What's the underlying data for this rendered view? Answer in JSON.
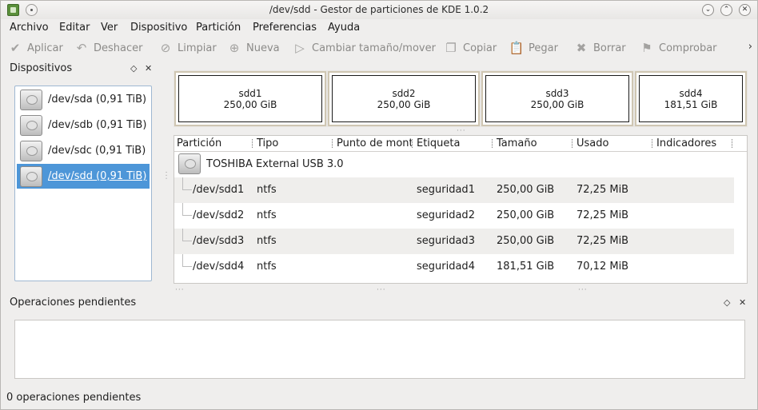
{
  "window": {
    "title": "/dev/sdd - Gestor de particiones de KDE 1.0.2"
  },
  "menu": [
    "Archivo",
    "Editar",
    "Ver",
    "Dispositivo",
    "Partición",
    "Preferencias",
    "Ayuda"
  ],
  "toolbar": {
    "apply": "Aplicar",
    "undo": "Deshacer",
    "clear": "Limpiar",
    "new": "Nueva",
    "resize": "Cambiar tamaño/mover",
    "copy": "Copiar",
    "paste": "Pegar",
    "delete": "Borrar",
    "check": "Comprobar",
    "more": "›"
  },
  "devices": {
    "title": "Dispositivos",
    "items": [
      "/dev/sda (0,91 TiB)",
      "/dev/sdb (0,91 TiB)",
      "/dev/sdc (0,91 TiB)",
      "/dev/sdd (0,91 TiB)"
    ],
    "selected": 3
  },
  "graph": [
    {
      "name": "sdd1",
      "size": "250,00 GiB"
    },
    {
      "name": "sdd2",
      "size": "250,00 GiB"
    },
    {
      "name": "sdd3",
      "size": "250,00 GiB"
    },
    {
      "name": "sdd4",
      "size": "181,51 GiB"
    }
  ],
  "table": {
    "columns": [
      "Partición",
      "Tipo",
      "Punto de mont",
      "Etiqueta",
      "Tamaño",
      "Usado",
      "Indicadores"
    ],
    "device_label": "TOSHIBA External USB 3.0",
    "rows": [
      {
        "partition": "/dev/sdd1",
        "type": "ntfs",
        "mount": "",
        "label": "seguridad1",
        "size": "250,00 GiB",
        "used": "72,25 MiB",
        "flags": ""
      },
      {
        "partition": "/dev/sdd2",
        "type": "ntfs",
        "mount": "",
        "label": "seguridad2",
        "size": "250,00 GiB",
        "used": "72,25 MiB",
        "flags": ""
      },
      {
        "partition": "/dev/sdd3",
        "type": "ntfs",
        "mount": "",
        "label": "seguridad3",
        "size": "250,00 GiB",
        "used": "72,25 MiB",
        "flags": ""
      },
      {
        "partition": "/dev/sdd4",
        "type": "ntfs",
        "mount": "",
        "label": "seguridad4",
        "size": "181,51 GiB",
        "used": "70,12 MiB",
        "flags": ""
      }
    ]
  },
  "pending": {
    "title": "Operaciones pendientes",
    "status": "0 operaciones pendientes"
  }
}
